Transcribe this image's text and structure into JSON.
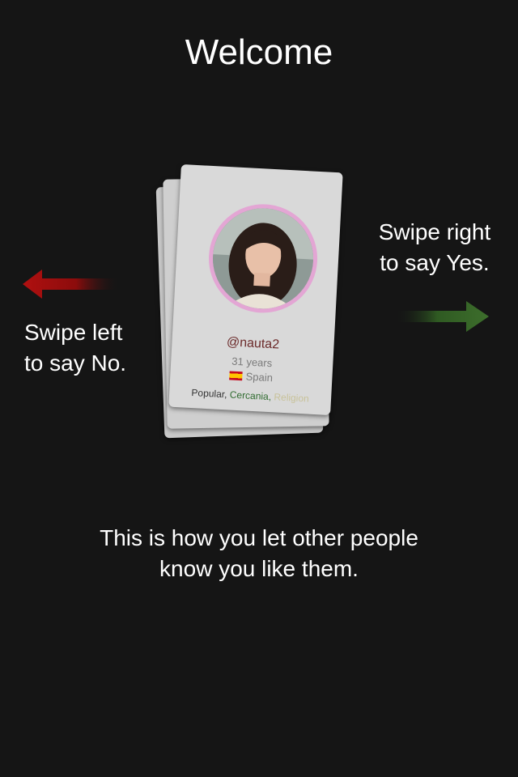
{
  "header": {
    "title": "Welcome"
  },
  "hints": {
    "left_line1": "Swipe left",
    "left_line2": "to say No.",
    "right_line1": "Swipe right",
    "right_line2": "to say Yes."
  },
  "profile_card": {
    "username": "@nauta2",
    "age": "31 years",
    "country": "Spain",
    "tags": [
      "Popular,",
      "Cercania,",
      "Religion"
    ]
  },
  "footer": {
    "line1": "This is how you let other people",
    "line2": "know you like them."
  },
  "colors": {
    "background": "#151515",
    "no_arrow": "#a01010",
    "yes_arrow": "#3d6e2c",
    "avatar_ring": "#e3a6d4"
  },
  "icons": [
    "left-arrow-icon",
    "right-arrow-icon",
    "spain-flag-icon"
  ]
}
